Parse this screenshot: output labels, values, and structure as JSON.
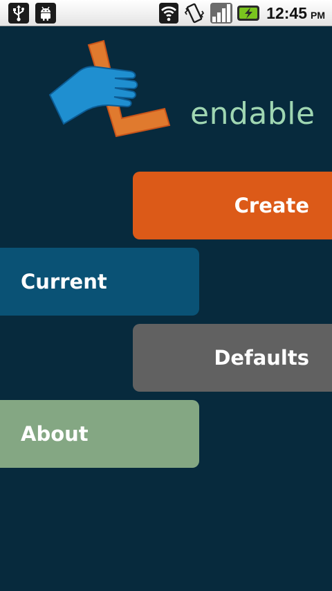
{
  "status_bar": {
    "icons": [
      "usb-icon",
      "android-debug-icon",
      "wifi-icon",
      "vibrate-icon",
      "signal-icon",
      "battery-charging-icon"
    ],
    "time": "12:45",
    "ampm": "PM"
  },
  "logo": {
    "text": "endable",
    "colors": {
      "l": "#e07a2e",
      "hand": "#1f8fd0",
      "text": "#9fd6b2"
    }
  },
  "menu": {
    "create": {
      "label": "Create",
      "color": "#dc5a18"
    },
    "current": {
      "label": "Current",
      "color": "#0a5275"
    },
    "defaults": {
      "label": "Defaults",
      "color": "#616161"
    },
    "about": {
      "label": "About",
      "color": "#84a783"
    }
  },
  "colors": {
    "background": "#072a3d"
  }
}
